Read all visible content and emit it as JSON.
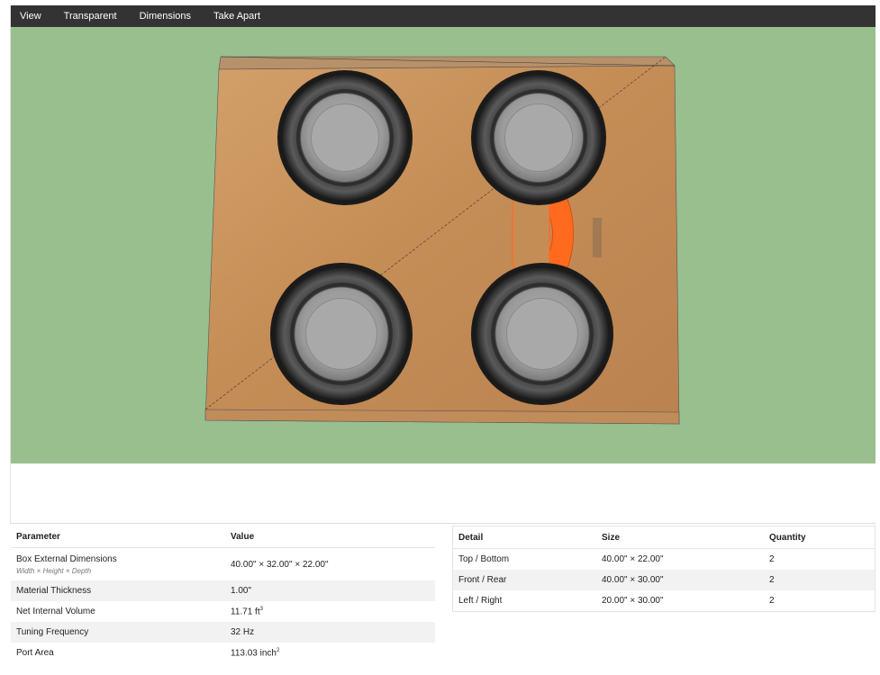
{
  "menu": {
    "items": [
      {
        "label": "View"
      },
      {
        "label": "Transparent"
      },
      {
        "label": "Dimensions"
      },
      {
        "label": "Take Apart"
      }
    ]
  },
  "viewer": {
    "background_color": "#99bf8f",
    "wood_color": "#c8925a",
    "port_color": "#ff6a1f",
    "speaker_count": 4
  },
  "parameters_table": {
    "headers": {
      "param": "Parameter",
      "value": "Value"
    },
    "rows": [
      {
        "param": "Box External Dimensions",
        "sub": "Width × Height × Depth",
        "value": "40.00\" × 32.00\" × 22.00\""
      },
      {
        "param": "Material Thickness",
        "value": "1.00\""
      },
      {
        "param": "Net Internal Volume",
        "value": "11.71 ft",
        "unit_sup": "3"
      },
      {
        "param": "Tuning Frequency",
        "value": "32 Hz"
      },
      {
        "param": "Port Area",
        "value": "113.03 inch",
        "unit_sup": "2"
      }
    ]
  },
  "cut_list_table": {
    "headers": {
      "detail": "Detail",
      "size": "Size",
      "quantity": "Quantity"
    },
    "rows": [
      {
        "detail": "Top / Bottom",
        "size": "40.00\" × 22.00\"",
        "quantity": "2"
      },
      {
        "detail": "Front / Rear",
        "size": "40.00\" × 30.00\"",
        "quantity": "2"
      },
      {
        "detail": "Left / Right",
        "size": "20.00\" × 30.00\"",
        "quantity": "2"
      }
    ]
  }
}
